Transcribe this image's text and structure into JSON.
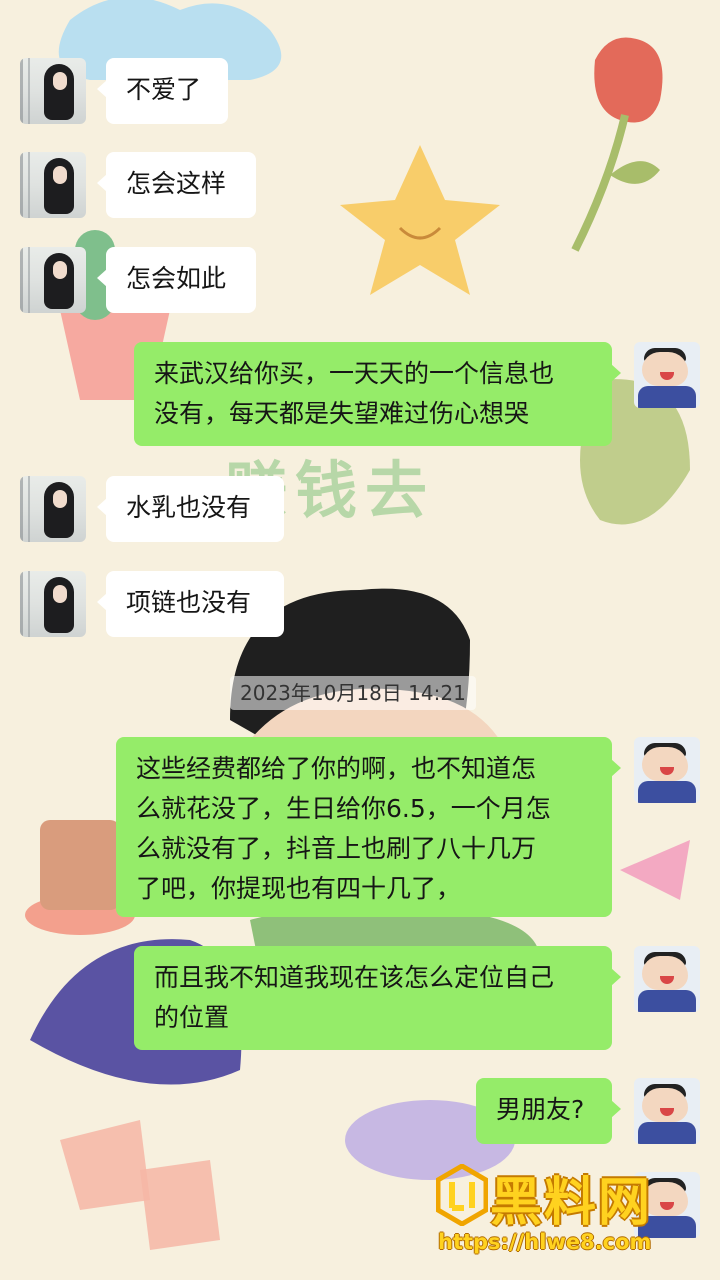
{
  "timestamp": "2023年10月18日 14:21",
  "messages": [
    {
      "side": "left",
      "text": "不爱了"
    },
    {
      "side": "left",
      "text": "怎会这样"
    },
    {
      "side": "left",
      "text": "怎会如此"
    },
    {
      "side": "right",
      "lines": [
        "来武汉给你买，一天天的一个信息也",
        "没有，每天都是失望难过伤心想哭"
      ]
    },
    {
      "side": "left",
      "text": "水乳也没有"
    },
    {
      "side": "left",
      "text": "项链也没有"
    },
    {
      "side": "right",
      "lines": [
        "这些经费都给了你的啊，也不知道怎",
        "么就花没了，生日给你6.5，一个月怎",
        "么就没有了，抖音上也刷了八十几万",
        "了吧，你提现也有四十几了，"
      ]
    },
    {
      "side": "right",
      "lines": [
        "而且我不知道我现在该怎么定位自己",
        "的位置"
      ]
    },
    {
      "side": "right",
      "text": "男朋友?"
    }
  ],
  "wallpaper": {
    "text": "赚钱去"
  },
  "watermark": {
    "title": "黑料网",
    "url": "https://hlwe8.com"
  },
  "colors": {
    "background": "#f7f0de",
    "bubble_left": "#ffffff",
    "bubble_right": "#95ec69"
  }
}
